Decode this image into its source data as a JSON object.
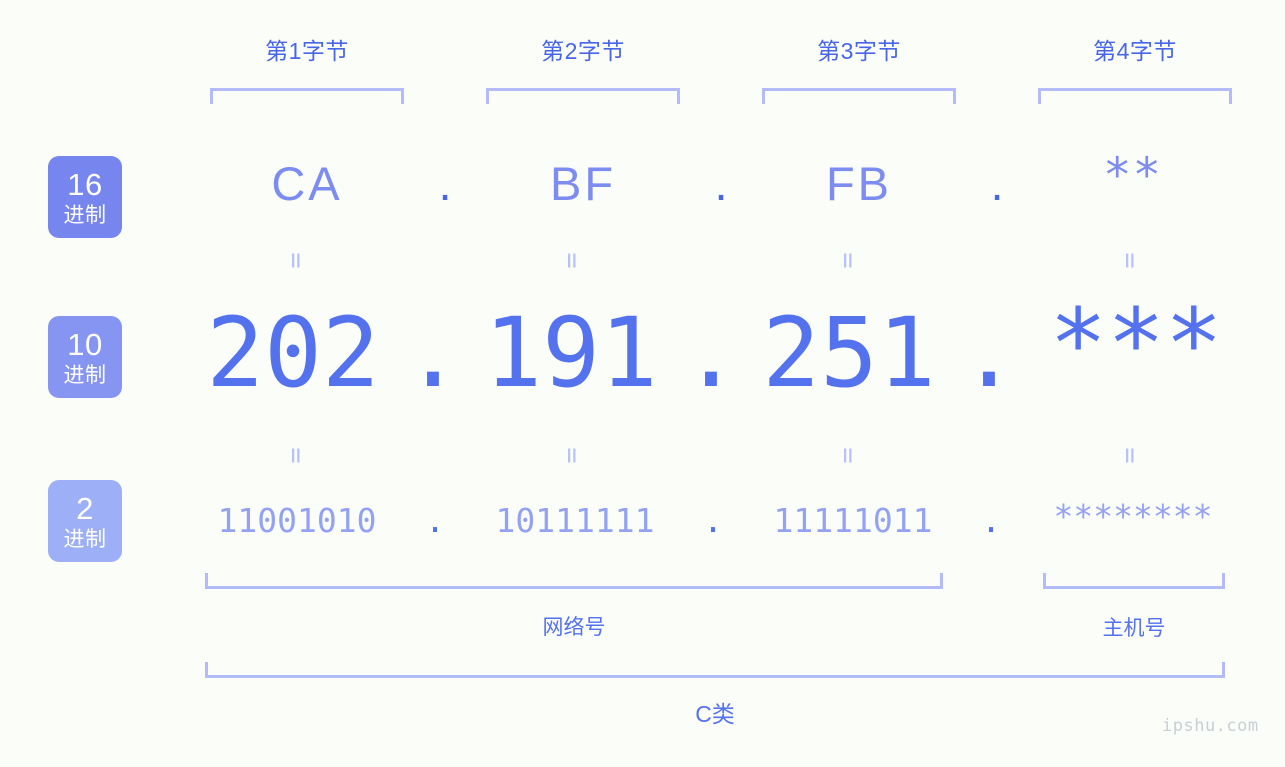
{
  "page": {
    "background_color": "#fbfdf9",
    "accent_color": "#5572ee",
    "bracket_color": "#b3bcf8"
  },
  "byte_headers": [
    {
      "label": "第1字节"
    },
    {
      "label": "第2字节"
    },
    {
      "label": "第3字节"
    },
    {
      "label": "第4字节"
    }
  ],
  "bases": [
    {
      "num": "16",
      "unit": "进制",
      "color": "#7786ee"
    },
    {
      "num": "10",
      "unit": "进制",
      "color": "#8795f2"
    },
    {
      "num": "2",
      "unit": "进制",
      "color": "#9db0f7"
    }
  ],
  "rows": {
    "hex": {
      "values": [
        "CA",
        "BF",
        "FB",
        "**"
      ],
      "separator": "."
    },
    "decimal": {
      "values": [
        "202",
        "191",
        "251",
        "***"
      ],
      "separator": "."
    },
    "binary": {
      "values": [
        "11001010",
        "10111111",
        "11111011",
        "********"
      ],
      "separator": "."
    }
  },
  "connectors": {
    "symbol": "="
  },
  "sections": {
    "network": "网络号",
    "host": "主机号",
    "class": "C类"
  },
  "watermark": "ipshu.com"
}
